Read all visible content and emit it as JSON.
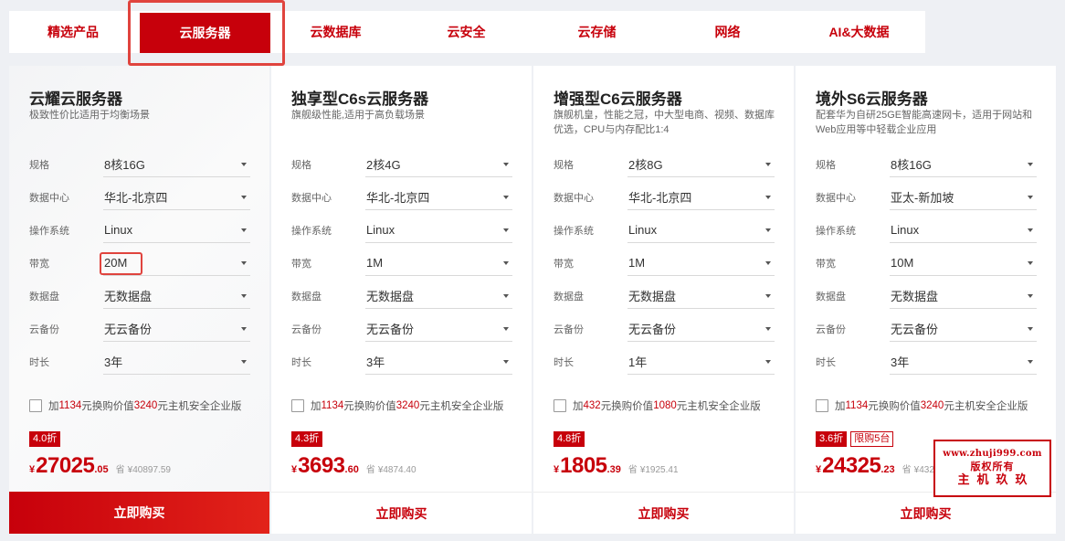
{
  "tabs": [
    {
      "label": "精选产品",
      "active": false
    },
    {
      "label": "云服务器",
      "active": true
    },
    {
      "label": "云数据库",
      "active": false
    },
    {
      "label": "云安全",
      "active": false
    },
    {
      "label": "云存储",
      "active": false
    },
    {
      "label": "网络",
      "active": false
    },
    {
      "label": "AI&大数据",
      "active": false
    }
  ],
  "spec_labels": {
    "spec": "规格",
    "datacenter": "数据中心",
    "os": "操作系统",
    "bandwidth": "带宽",
    "disk": "数据盘",
    "backup": "云备份",
    "duration": "时长"
  },
  "cards": [
    {
      "title": "云耀云服务器",
      "desc": "极致性价比适用于均衡场景",
      "specs": {
        "spec": "8核16G",
        "datacenter": "华北-北京四",
        "os": "Linux",
        "bandwidth": "20M",
        "disk": "无数据盘",
        "backup": "无云备份",
        "duration": "3年"
      },
      "promo": {
        "prefix": "加",
        "amount": "1134",
        "mid": "元换购价值",
        "value": "3240",
        "suffix": "元主机安全企业版"
      },
      "discount": "4.0折",
      "limit": "",
      "price": {
        "currency": "¥",
        "int": "27025",
        "dec": ".05",
        "orig_label": "省",
        "orig": "¥40897.59"
      },
      "buy": "立即购买"
    },
    {
      "title": "独享型C6s云服务器",
      "desc": "旗舰级性能,适用于高负载场景",
      "specs": {
        "spec": "2核4G",
        "datacenter": "华北-北京四",
        "os": "Linux",
        "bandwidth": "1M",
        "disk": "无数据盘",
        "backup": "无云备份",
        "duration": "3年"
      },
      "promo": {
        "prefix": "加",
        "amount": "1134",
        "mid": "元换购价值",
        "value": "3240",
        "suffix": "元主机安全企业版"
      },
      "discount": "4.3折",
      "limit": "",
      "price": {
        "currency": "¥",
        "int": "3693",
        "dec": ".60",
        "orig_label": "省",
        "orig": "¥4874.40"
      },
      "buy": "立即购买"
    },
    {
      "title": "增强型C6云服务器",
      "desc": "旗舰机皇，性能之冠，中大型电商、视频、数据库优选，CPU与内存配比1:4",
      "specs": {
        "spec": "2核8G",
        "datacenter": "华北-北京四",
        "os": "Linux",
        "bandwidth": "1M",
        "disk": "无数据盘",
        "backup": "无云备份",
        "duration": "1年"
      },
      "promo": {
        "prefix": "加",
        "amount": "432",
        "mid": "元换购价值",
        "value": "1080",
        "suffix": "元主机安全企业版"
      },
      "discount": "4.8折",
      "limit": "",
      "price": {
        "currency": "¥",
        "int": "1805",
        "dec": ".39",
        "orig_label": "省",
        "orig": "¥1925.41"
      },
      "buy": "立即购买"
    },
    {
      "title": "境外S6云服务器",
      "desc": "配套华为自研25GE智能高速网卡，适用于网站和Web应用等中轻载企业应用",
      "specs": {
        "spec": "8核16G",
        "datacenter": "亚太-新加坡",
        "os": "Linux",
        "bandwidth": "10M",
        "disk": "无数据盘",
        "backup": "无云备份",
        "duration": "3年"
      },
      "promo": {
        "prefix": "加",
        "amount": "1134",
        "mid": "元换购价值",
        "value": "3240",
        "suffix": "元主机安全企业版"
      },
      "discount": "3.6折",
      "limit": "限购5台",
      "price": {
        "currency": "¥",
        "int": "24325",
        "dec": ".23",
        "orig_label": "省",
        "orig": "¥43238.86"
      },
      "buy": "立即购买"
    }
  ],
  "watermark": {
    "url": "www.zhuji999.com",
    "line2": "版权所有",
    "line3": "主机玖玖"
  },
  "colors": {
    "brand_red": "#c7000b",
    "highlight": "#e0443e"
  }
}
